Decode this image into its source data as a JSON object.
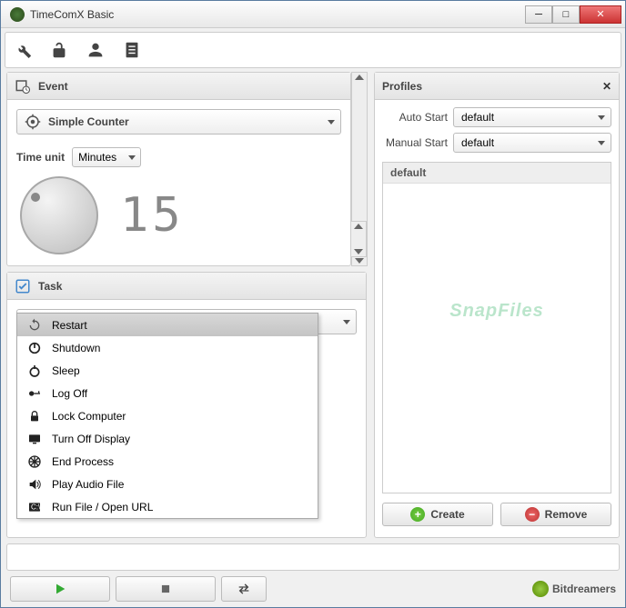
{
  "window": {
    "title": "TimeComX Basic"
  },
  "toolbar": {
    "icons": [
      "wrench-icon",
      "unlock-icon",
      "user-icon",
      "document-icon"
    ]
  },
  "event": {
    "header": "Event",
    "counterLabel": "Simple Counter",
    "timeUnitLabel": "Time unit",
    "timeUnitValue": "Minutes",
    "counterValue": "15"
  },
  "task": {
    "header": "Task",
    "selected": "Restart",
    "options": [
      {
        "label": "Restart",
        "icon": "restart-icon"
      },
      {
        "label": "Shutdown",
        "icon": "shutdown-icon"
      },
      {
        "label": "Sleep",
        "icon": "sleep-icon"
      },
      {
        "label": "Log Off",
        "icon": "logoff-icon"
      },
      {
        "label": "Lock Computer",
        "icon": "lock-icon"
      },
      {
        "label": "Turn Off Display",
        "icon": "display-icon"
      },
      {
        "label": "End Process",
        "icon": "endprocess-icon"
      },
      {
        "label": "Play Audio File",
        "icon": "audio-icon"
      },
      {
        "label": "Run File / Open URL",
        "icon": "run-icon"
      }
    ]
  },
  "profiles": {
    "header": "Profiles",
    "autoStartLabel": "Auto Start",
    "autoStartValue": "default",
    "manualStartLabel": "Manual Start",
    "manualStartValue": "default",
    "listItems": [
      "default"
    ],
    "createLabel": "Create",
    "removeLabel": "Remove"
  },
  "watermark": "SnapFiles",
  "brand": "Bitdreamers"
}
